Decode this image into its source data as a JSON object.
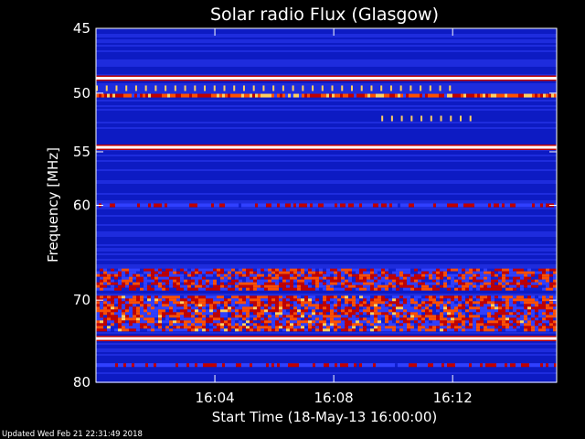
{
  "footer": {
    "updated": "Updated Wed Feb 21 22:31:49 2018"
  },
  "chart_data": {
    "type": "heatmap",
    "title": "Solar radio Flux (Glasgow)",
    "xlabel": "Start Time (18-May-13 16:00:00)",
    "ylabel": "Frequency [MHz]",
    "xaxis": {
      "unit": "minutes after 16:00",
      "range": [
        0,
        15.5
      ],
      "ticks": [
        {
          "value": 4,
          "label": "16:04"
        },
        {
          "value": 8,
          "label": "16:08"
        },
        {
          "value": 12,
          "label": "16:12"
        }
      ]
    },
    "yaxis": {
      "unit": "MHz",
      "scale": "log",
      "range": [
        45,
        80
      ],
      "inverted": true,
      "ticks": [
        {
          "value": 45,
          "label": "45"
        },
        {
          "value": 50,
          "label": "50"
        },
        {
          "value": 55,
          "label": "55"
        },
        {
          "value": 60,
          "label": "60"
        },
        {
          "value": 70,
          "label": "70"
        },
        {
          "value": 80,
          "label": "80"
        }
      ]
    },
    "colormap": [
      "#00007a",
      "#1020d0",
      "#3040ff",
      "#c00000",
      "#ff5000",
      "#ffd060",
      "#ffffff"
    ],
    "features": [
      {
        "kind": "constant-band",
        "freq_mhz": 48.8,
        "intensity": 0.95
      },
      {
        "kind": "constant-band",
        "freq_mhz": 54.6,
        "intensity": 0.97
      },
      {
        "kind": "constant-band",
        "freq_mhz": 74.5,
        "intensity": 0.97
      },
      {
        "kind": "noisy-band",
        "freq_mhz": 50.2,
        "intensity": 0.72
      },
      {
        "kind": "noisy-band",
        "freq_mhz": 60.0,
        "intensity": 0.45
      },
      {
        "kind": "noisy-region",
        "freq_range_mhz": [
          66.5,
          68.8
        ],
        "intensity": 0.55
      },
      {
        "kind": "noisy-region",
        "freq_range_mhz": [
          69.5,
          73.5
        ],
        "intensity": 0.6
      },
      {
        "kind": "noisy-band",
        "freq_mhz": 77.8,
        "intensity": 0.45
      },
      {
        "kind": "bursts",
        "freq_mhz": 49.6,
        "time_range_min": [
          0,
          12
        ]
      },
      {
        "kind": "bursts",
        "freq_mhz": 52.1,
        "time_range_min": [
          9.6,
          12.6
        ]
      }
    ]
  }
}
